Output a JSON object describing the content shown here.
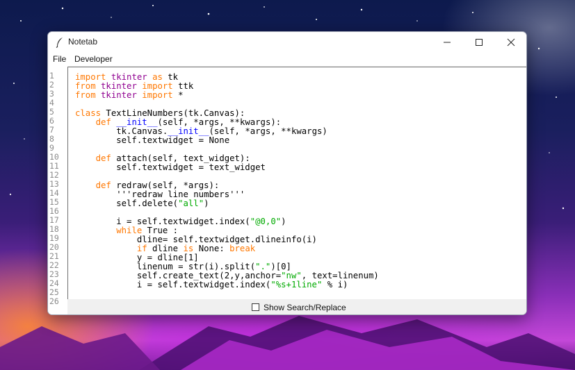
{
  "window": {
    "title": "Notetab",
    "controls": {
      "minimize": "minimize-icon",
      "maximize": "maximize-icon",
      "close": "close-icon"
    }
  },
  "menu": [
    {
      "label": "File"
    },
    {
      "label": "Developer"
    }
  ],
  "line_numbers": [
    "1",
    "2",
    "3",
    "4",
    "5",
    "6",
    "7",
    "8",
    "9",
    "10",
    "11",
    "12",
    "13",
    "14",
    "15",
    "16",
    "17",
    "18",
    "19",
    "20",
    "21",
    "22",
    "23",
    "24",
    "25",
    "26"
  ],
  "code_lines": [
    [
      {
        "t": "import ",
        "c": "kw"
      },
      {
        "t": "tkinter ",
        "c": "bi"
      },
      {
        "t": "as",
        "c": "kw"
      },
      {
        "t": " tk",
        "c": ""
      }
    ],
    [
      {
        "t": "from ",
        "c": "kw"
      },
      {
        "t": "tkinter ",
        "c": "bi"
      },
      {
        "t": "import",
        "c": "kw"
      },
      {
        "t": " ttk",
        "c": ""
      }
    ],
    [
      {
        "t": "from ",
        "c": "kw"
      },
      {
        "t": "tkinter ",
        "c": "bi"
      },
      {
        "t": "import",
        "c": "kw"
      },
      {
        "t": " *",
        "c": ""
      }
    ],
    [],
    [
      {
        "t": "class ",
        "c": "kw"
      },
      {
        "t": "TextLineNumbers(tk.Canvas):",
        "c": ""
      }
    ],
    [
      {
        "t": "    ",
        "c": ""
      },
      {
        "t": "def ",
        "c": "kw"
      },
      {
        "t": "__init__",
        "c": "def"
      },
      {
        "t": "(self, *args, **kwargs):",
        "c": ""
      }
    ],
    [
      {
        "t": "        tk.Canvas.",
        "c": ""
      },
      {
        "t": "__init__",
        "c": "def"
      },
      {
        "t": "(self, *args, **kwargs)",
        "c": ""
      }
    ],
    [
      {
        "t": "        self.textwidget = None",
        "c": ""
      }
    ],
    [],
    [
      {
        "t": "    ",
        "c": ""
      },
      {
        "t": "def ",
        "c": "kw"
      },
      {
        "t": "attach(self, text_widget):",
        "c": ""
      }
    ],
    [
      {
        "t": "        self.textwidget = text_widget",
        "c": ""
      }
    ],
    [],
    [
      {
        "t": "    ",
        "c": ""
      },
      {
        "t": "def ",
        "c": "kw"
      },
      {
        "t": "redraw(self, *args):",
        "c": ""
      }
    ],
    [
      {
        "t": "        '''redraw line numbers'''",
        "c": ""
      }
    ],
    [
      {
        "t": "        self.delete(",
        "c": ""
      },
      {
        "t": "\"all\"",
        "c": "str"
      },
      {
        "t": ")",
        "c": ""
      }
    ],
    [],
    [
      {
        "t": "        i = self.textwidget.index(",
        "c": ""
      },
      {
        "t": "\"@0,0\"",
        "c": "str"
      },
      {
        "t": ")",
        "c": ""
      }
    ],
    [
      {
        "t": "        ",
        "c": ""
      },
      {
        "t": "while",
        "c": "kw"
      },
      {
        "t": " True :",
        "c": ""
      }
    ],
    [
      {
        "t": "            dline= self.textwidget.dlineinfo(i)",
        "c": ""
      }
    ],
    [
      {
        "t": "            ",
        "c": ""
      },
      {
        "t": "if",
        "c": "kw"
      },
      {
        "t": " dline ",
        "c": ""
      },
      {
        "t": "is",
        "c": "kw"
      },
      {
        "t": " None: ",
        "c": ""
      },
      {
        "t": "break",
        "c": "kw"
      }
    ],
    [
      {
        "t": "            y = dline[1]",
        "c": ""
      }
    ],
    [
      {
        "t": "            linenum = str(i).split(",
        "c": ""
      },
      {
        "t": "\".\"",
        "c": "str"
      },
      {
        "t": ")[0]",
        "c": ""
      }
    ],
    [
      {
        "t": "            self.create_text(2,y,anchor=",
        "c": ""
      },
      {
        "t": "\"nw\"",
        "c": "str"
      },
      {
        "t": ", text=linenum)",
        "c": ""
      }
    ],
    [
      {
        "t": "            i = self.textwidget.index(",
        "c": ""
      },
      {
        "t": "\"%s+1line\"",
        "c": "str"
      },
      {
        "t": " % i)",
        "c": ""
      }
    ],
    [],
    []
  ],
  "footer": {
    "checkbox_label": "Show Search/Replace",
    "checkbox_checked": false
  },
  "colors": {
    "keyword": "#ff7700",
    "string": "#00aa00",
    "builtin": "#900090",
    "definition": "#0000ff"
  }
}
